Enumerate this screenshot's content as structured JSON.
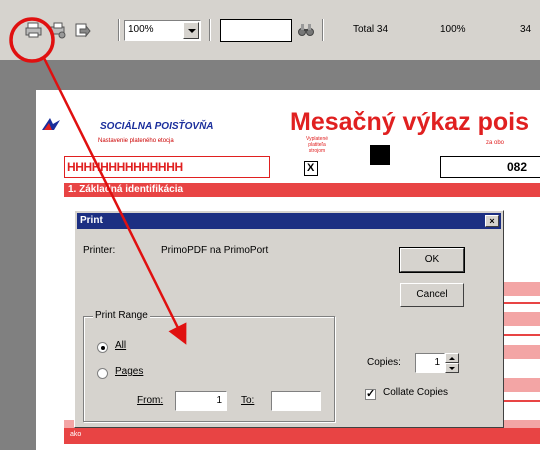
{
  "toolbar": {
    "zoom_value": "100%",
    "find_value": "",
    "total_label": "Total 34",
    "zoom_readout": "100%",
    "page_readout": "34",
    "icons": [
      "printer-icon",
      "print-setup-icon",
      "export-icon",
      "binoculars-icon"
    ]
  },
  "document": {
    "logo_text": "SOCIÁLNA POISŤOVŇA",
    "logo_sub": "Nastavenie plateného etocja",
    "title": "Mesačný výkaz pois",
    "title_sub": "za obo",
    "hh_field": "HHHHHHHHHHHHHH",
    "small_label": "Vyplatené platiteľa strojom",
    "x_mark": "X",
    "number_field": "082",
    "section_header": "1. Základná identifikácia",
    "bottom_label": "ako"
  },
  "dialog": {
    "title": "Print",
    "close_glyph": "×",
    "printer_label": "Printer:",
    "printer_value": "PrimoPDF na PrimoPort",
    "ok_label": "OK",
    "cancel_label": "Cancel",
    "print_range_label": "Print Range",
    "all_label": "All",
    "pages_label": "Pages",
    "from_label": "From:",
    "from_value": "1",
    "to_label": "To:",
    "to_value": "",
    "copies_label": "Copies:",
    "copies_value": "1",
    "collate_label": "Collate Copies",
    "all_selected": true,
    "collate_checked": true
  },
  "colors": {
    "annotation_red": "#e01010",
    "form_red": "#e02020",
    "dialog_title_bg": "#1c2f82",
    "chrome_gray": "#d6d3ce"
  }
}
